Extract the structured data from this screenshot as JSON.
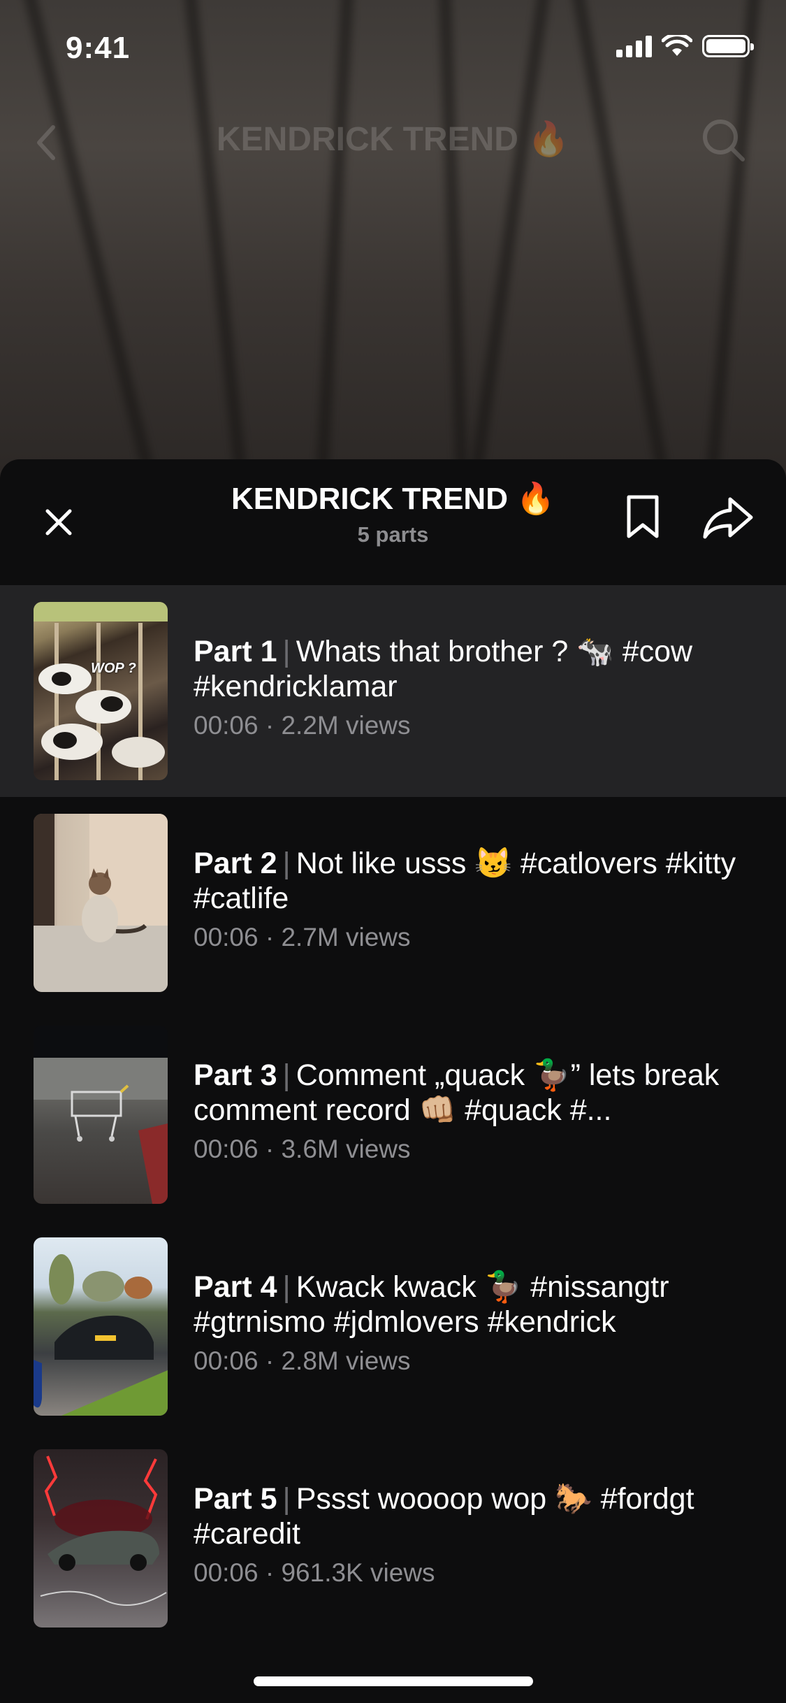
{
  "status_bar": {
    "time": "9:41"
  },
  "background_nav": {
    "title": "KENDRICK TREND 🔥"
  },
  "sheet": {
    "title": "KENDRICK TREND 🔥",
    "subtitle": "5 parts"
  },
  "parts": [
    {
      "part": "Part 1",
      "separator": "|",
      "description": "Whats that brother ? 🐄 #cow #kendricklamar",
      "meta": "00:06 · 2.2M views",
      "thumb_text": "WOP ?"
    },
    {
      "part": "Part 2",
      "separator": "|",
      "description": "Not like usss 😼 #catlovers #kitty #catlife",
      "meta": "00:06 · 2.7M views"
    },
    {
      "part": "Part 3",
      "separator": "|",
      "description": "Comment „quack 🦆” lets break comment record 👊🏼 #quack #...",
      "meta": "00:06 · 3.6M views"
    },
    {
      "part": "Part 4",
      "separator": "|",
      "description": "Kwack kwack 🦆 #nissangtr #gtrnismo #jdmlovers #kendrick",
      "meta": "00:06 · 2.8M views"
    },
    {
      "part": "Part 5",
      "separator": "|",
      "description": "Pssst woooop wop 🐎 #fordgt #caredit",
      "meta": "00:06 · 961.3K views"
    }
  ],
  "icons": {
    "close": "close-icon",
    "bookmark": "bookmark-icon",
    "share": "share-icon",
    "back": "chevron-left-icon",
    "search": "search-icon"
  },
  "colors": {
    "sheet_bg": "#0d0d0e",
    "active_row_bg": "#232325",
    "meta_text": "#8e8e92"
  }
}
